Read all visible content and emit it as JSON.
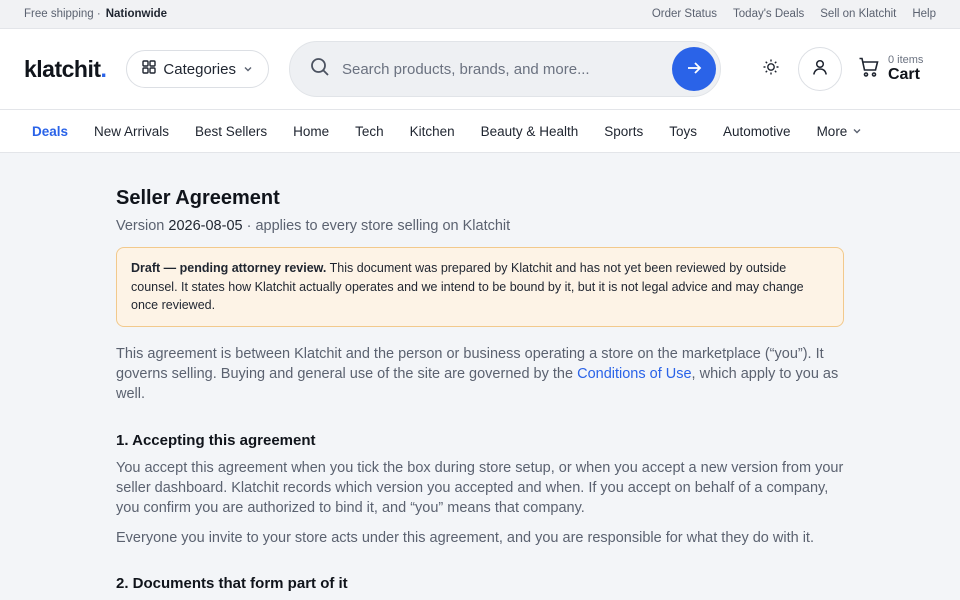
{
  "topbar": {
    "shipping_label": "Free shipping ·",
    "shipping_value": "Nationwide",
    "links": [
      "Order Status",
      "Today's Deals",
      "Sell on Klatchit",
      "Help"
    ]
  },
  "header": {
    "logo_text": "klatchit",
    "logo_dot": ".",
    "categories_label": "Categories",
    "search_placeholder": "Search products, brands, and more...",
    "cart_count": "0 items",
    "cart_label": "Cart"
  },
  "nav": {
    "items": [
      "Deals",
      "New Arrivals",
      "Best Sellers",
      "Home",
      "Tech",
      "Kitchen",
      "Beauty & Health",
      "Sports",
      "Toys",
      "Automotive"
    ],
    "more_label": "More"
  },
  "doc": {
    "title": "Seller Agreement",
    "version_prefix": "Version",
    "version_value": "2026-08-05",
    "version_suffix": "· applies to every store selling on Klatchit",
    "draft_bold": "Draft — pending attorney review.",
    "draft_text": "This document was prepared by Klatchit and has not yet been reviewed by outside counsel. It states how Klatchit actually operates and we intend to be bound by it, but it is not legal advice and may change once reviewed.",
    "intro_before": "This agreement is between Klatchit and the person or business operating a store on the marketplace (“you”). It governs selling. Buying and general use of the site are governed by the",
    "intro_link": "Conditions of Use",
    "intro_after": ", which apply to you as well.",
    "s1_title": "1. Accepting this agreement",
    "s1_p1": "You accept this agreement when you tick the box during store setup, or when you accept a new version from your seller dashboard. Klatchit records which version you accepted and when. If you accept on behalf of a company, you confirm you are authorized to bind it, and “you” means that company.",
    "s1_p2": "Everyone you invite to your store acts under this agreement, and you are responsible for what they do with it.",
    "s2_title": "2. Documents that form part of it"
  },
  "colors": {
    "accent": "#2a63e8",
    "draft_bg": "#fdf3e6",
    "draft_border": "#f2c98c"
  }
}
